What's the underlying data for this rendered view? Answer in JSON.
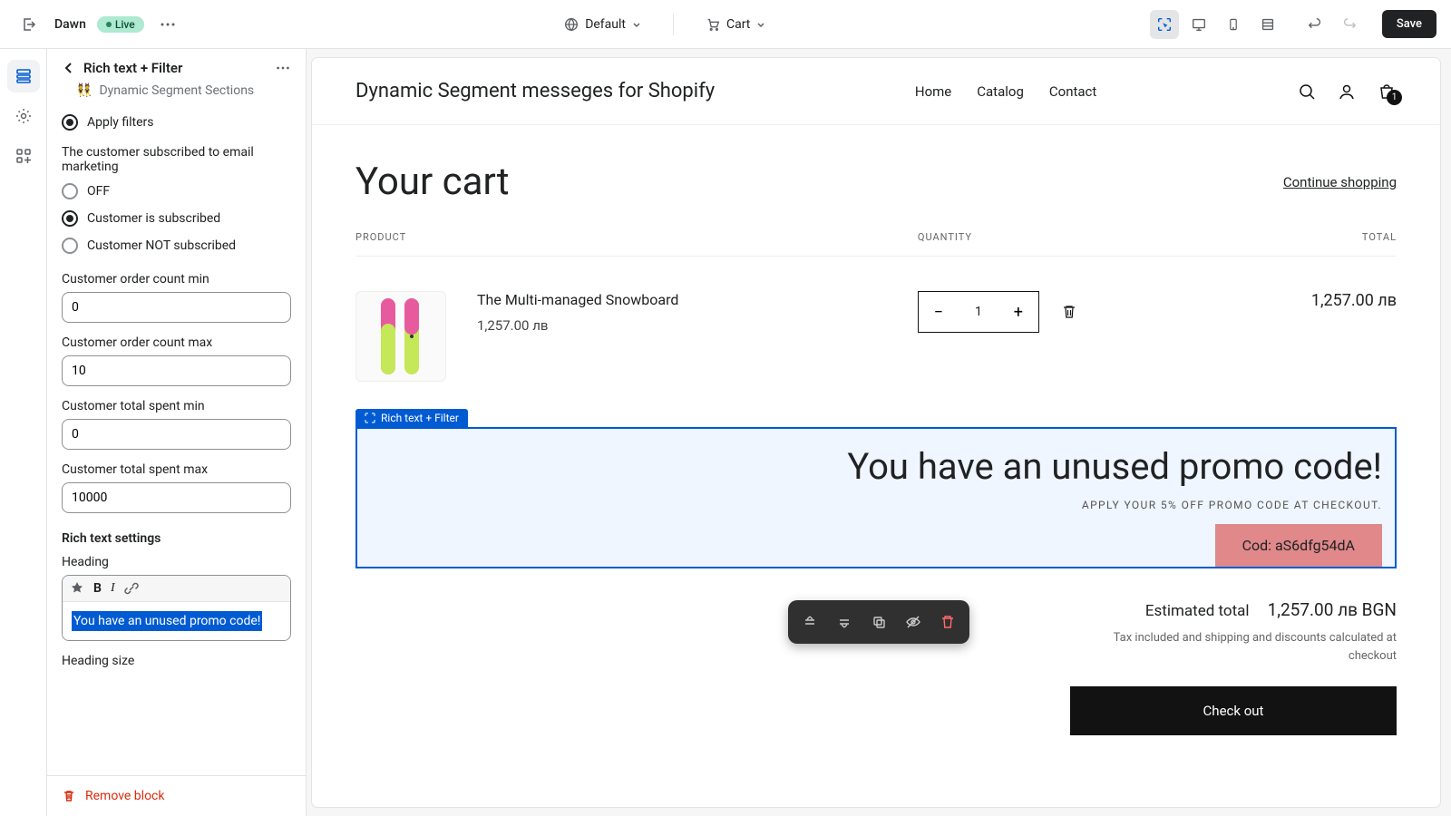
{
  "topbar": {
    "theme_name": "Dawn",
    "live_badge": "Live",
    "context_label": "Default",
    "cart_label": "Cart",
    "save_label": "Save"
  },
  "sidebar": {
    "title": "Rich text + Filter",
    "subtitle": "Dynamic Segment Sections",
    "filters": {
      "apply_label": "Apply filters",
      "email_group": "The customer subscribed to email marketing",
      "email_off": "OFF",
      "email_sub": "Customer is subscribed",
      "email_notsub": "Customer NOT subscribed",
      "order_min_label": "Customer order count min",
      "order_min_val": "0",
      "order_max_label": "Customer order count max",
      "order_max_val": "10",
      "spent_min_label": "Customer total spent min",
      "spent_min_val": "0",
      "spent_max_label": "Customer total spent max",
      "spent_max_val": "10000"
    },
    "rte": {
      "section": "Rich text settings",
      "heading_label": "Heading",
      "heading_val": "You have an unused promo code!",
      "heading_size_label": "Heading size"
    },
    "remove_label": "Remove block"
  },
  "preview": {
    "store_name": "Dynamic Segment messeges for Shopify",
    "nav": {
      "home": "Home",
      "catalog": "Catalog",
      "contact": "Contact"
    },
    "cart_count": "1",
    "cart_title": "Your cart",
    "continue": "Continue shopping",
    "headers": {
      "product": "PRODUCT",
      "qty": "QUANTITY",
      "total": "TOTAL"
    },
    "line": {
      "name": "The Multi-managed Snowboard",
      "price": "1,257.00 лв",
      "qty": "1",
      "total": "1,257.00 лв"
    },
    "promo": {
      "tag": "Rich text + Filter",
      "heading": "You have an unused promo code!",
      "sub": "APPLY YOUR 5% OFF PROMO CODE AT CHECKOUT.",
      "code": "Cod: aS6dfg54dA"
    },
    "totals": {
      "est_label": "Estimated total",
      "est_val": "1,257.00 лв BGN",
      "tax": "Tax included and shipping and discounts calculated at checkout",
      "checkout": "Check out"
    }
  }
}
